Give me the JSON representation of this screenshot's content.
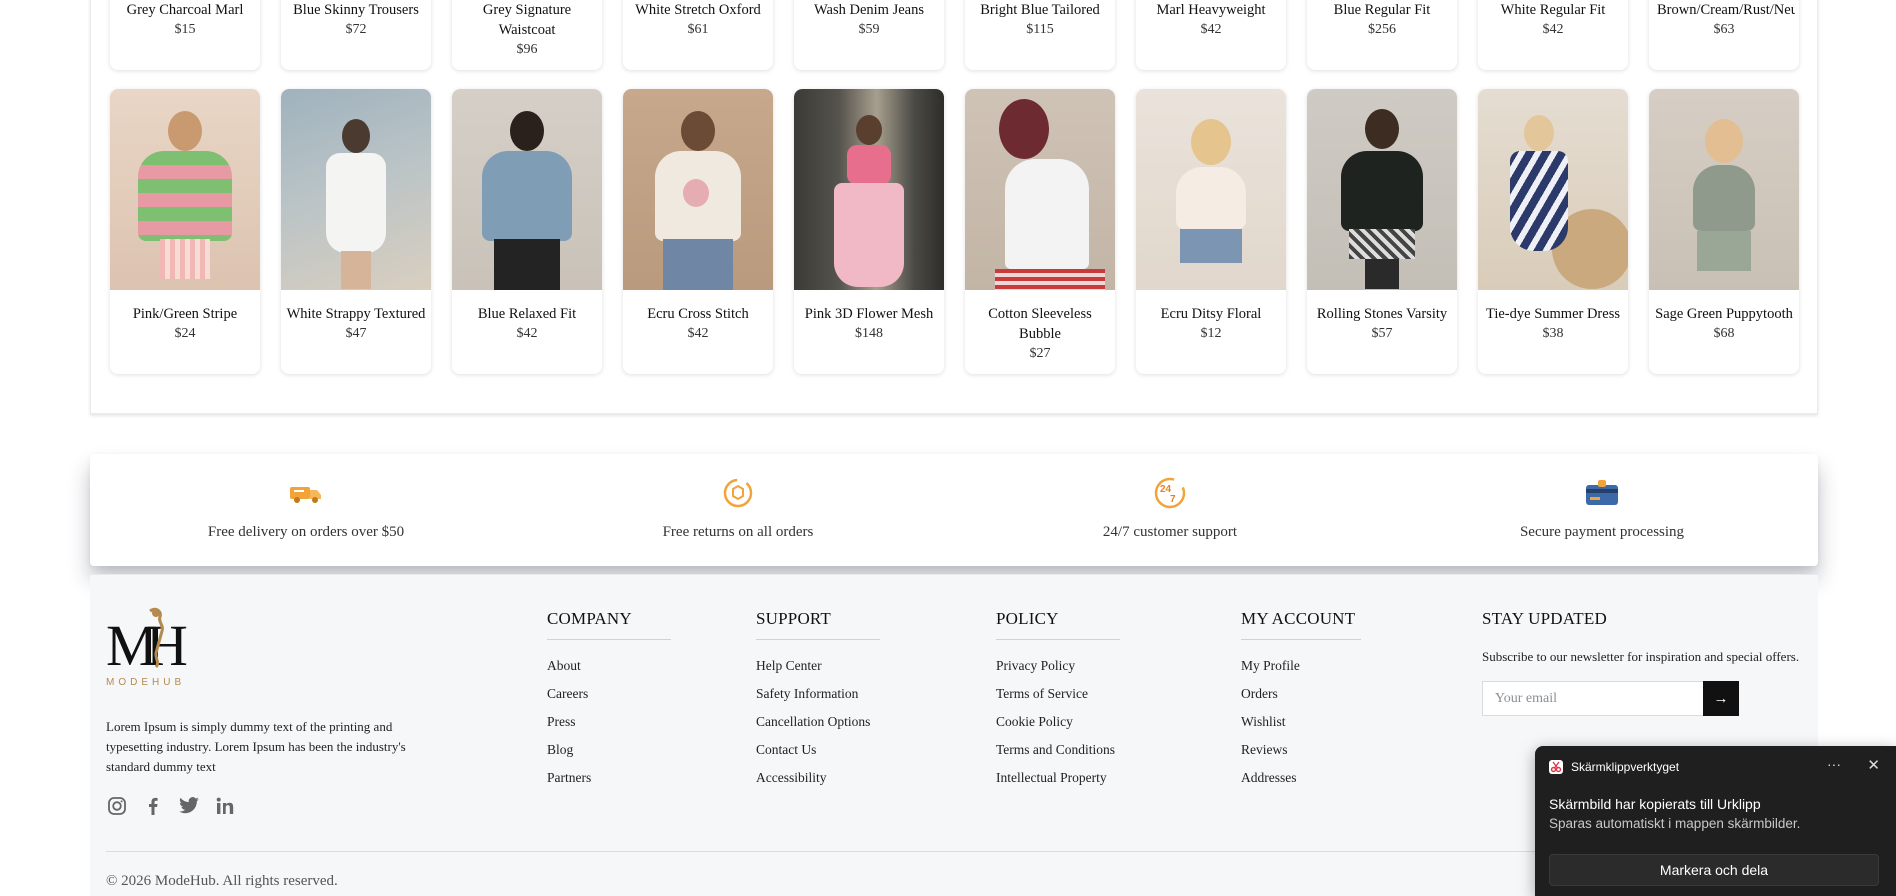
{
  "products_top": [
    {
      "name": "Grey Charcoal Marl",
      "price": "$15"
    },
    {
      "name": "Blue Skinny Trousers",
      "price": "$72"
    },
    {
      "name": "Grey Signature Waistcoat",
      "price": "$96"
    },
    {
      "name": "White Stretch Oxford",
      "price": "$61"
    },
    {
      "name": "Wash Denim Jeans",
      "price": "$59"
    },
    {
      "name": "Bright Blue Tailored",
      "price": "$115"
    },
    {
      "name": "Marl Heavyweight",
      "price": "$42"
    },
    {
      "name": "Blue Regular Fit",
      "price": "$256"
    },
    {
      "name": "White Regular Fit",
      "price": "$42"
    },
    {
      "name": "Brown/Cream/Rust/Neutra",
      "price": "$63"
    }
  ],
  "products_bottom": [
    {
      "name": "Pink/Green Stripe",
      "price": "$24"
    },
    {
      "name": "White Strappy Textured",
      "price": "$47"
    },
    {
      "name": "Blue Relaxed Fit",
      "price": "$42"
    },
    {
      "name": "Ecru Cross Stitch",
      "price": "$42"
    },
    {
      "name": "Pink 3D Flower Mesh",
      "price": "$148"
    },
    {
      "name": "Cotton Sleeveless Bubble",
      "price": "$27"
    },
    {
      "name": "Ecru Ditsy Floral",
      "price": "$12"
    },
    {
      "name": "Rolling Stones Varsity",
      "price": "$57"
    },
    {
      "name": "Tie-dye Summer Dress",
      "price": "$38"
    },
    {
      "name": "Sage Green Puppytooth",
      "price": "$68"
    }
  ],
  "features": [
    {
      "icon": "delivery-truck-icon",
      "text": "Free delivery on orders over $50"
    },
    {
      "icon": "returns-box-icon",
      "text": "Free returns on all orders"
    },
    {
      "icon": "support-24-7-icon",
      "text": "24/7 customer support"
    },
    {
      "icon": "secure-card-icon",
      "text": "Secure payment processing"
    }
  ],
  "footer": {
    "logo_text": "MODEHUB",
    "about": "Lorem Ipsum is simply dummy text of the printing and typesetting industry. Lorem Ipsum has been the industry's standard dummy text",
    "company": {
      "title": "COMPANY",
      "links": [
        "About",
        "Careers",
        "Press",
        "Blog",
        "Partners"
      ]
    },
    "support": {
      "title": "SUPPORT",
      "links": [
        "Help Center",
        "Safety Information",
        "Cancellation Options",
        "Contact Us",
        "Accessibility"
      ]
    },
    "policy": {
      "title": "POLICY",
      "links": [
        "Privacy Policy",
        "Terms of Service",
        "Cookie Policy",
        "Terms and Conditions",
        "Intellectual Property"
      ]
    },
    "account": {
      "title": "MY ACCOUNT",
      "links": [
        "My Profile",
        "Orders",
        "Wishlist",
        "Reviews",
        "Addresses"
      ]
    },
    "newsletter": {
      "title": "STAY UPDATED",
      "text": "Subscribe to our newsletter for inspiration and special offers.",
      "placeholder": "Your email",
      "button": "→"
    },
    "copyright": "© 2026 ModeHub. All rights reserved."
  },
  "toast": {
    "app": "Skärmklippverktyget",
    "more": "···",
    "close": "✕",
    "title": "Skärmbild har kopierats till Urklipp",
    "body": "Sparas automatiskt i mappen skärmbilder.",
    "button": "Markera och dela"
  },
  "colors": {
    "accent_orange": "#f2a33a",
    "button_black": "#111111",
    "toast_bg": "#1f1f1f"
  }
}
